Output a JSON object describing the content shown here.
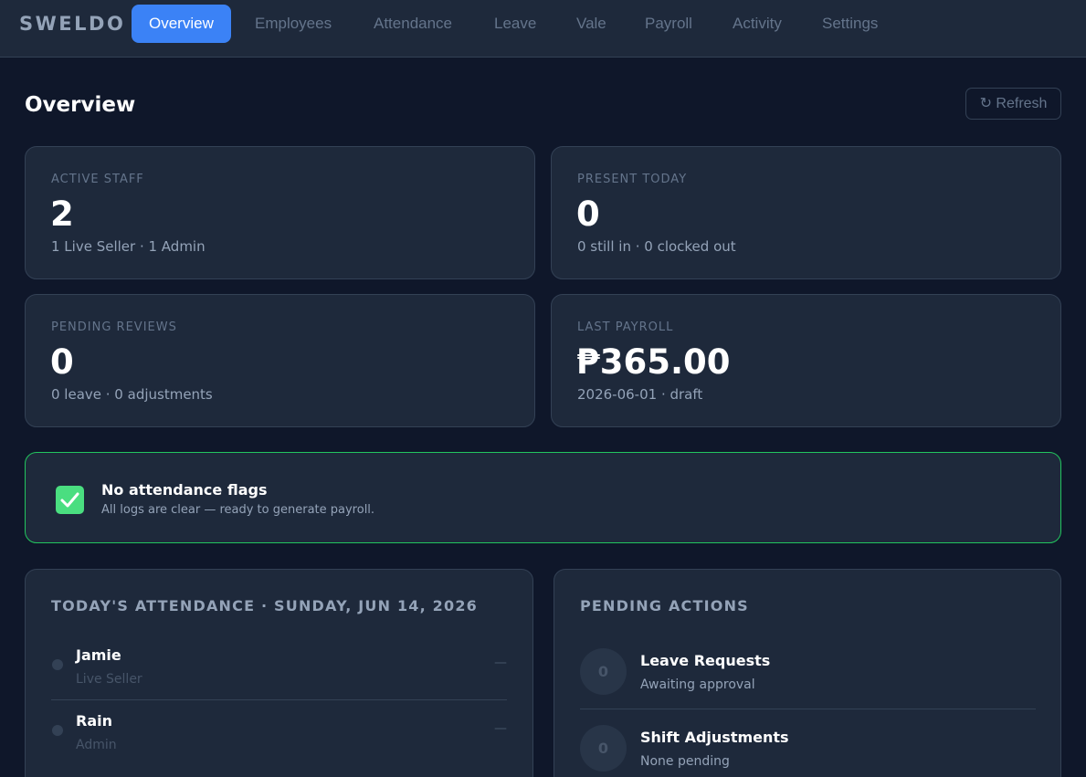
{
  "app": {
    "logo": "SWELDO"
  },
  "nav": {
    "tabs": [
      {
        "label": "Overview",
        "active": true
      },
      {
        "label": "Employees"
      },
      {
        "label": "Attendance"
      },
      {
        "label": "Leave"
      },
      {
        "label": "Vale"
      },
      {
        "label": "Payroll"
      },
      {
        "label": "Activity"
      },
      {
        "label": "Settings"
      }
    ]
  },
  "header": {
    "title": "Overview",
    "refresh_label": "↻ Refresh"
  },
  "stats": [
    {
      "label": "ACTIVE STAFF",
      "value": "2",
      "sub": "1 Live Seller · 1 Admin"
    },
    {
      "label": "PRESENT TODAY",
      "value": "0",
      "sub": "0 still in · 0 clocked out"
    },
    {
      "label": "PENDING REVIEWS",
      "value": "0",
      "sub": "0 leave · 0 adjustments"
    },
    {
      "label": "LAST PAYROLL",
      "value": "₱365.00",
      "sub": "2026-06-01 · draft"
    }
  ],
  "flag_banner": {
    "icon": "check-icon",
    "title": "No attendance flags",
    "subtitle": "All logs are clear — ready to generate payroll."
  },
  "attendance": {
    "title": "TODAY'S ATTENDANCE · SUNDAY, JUN 14, 2026",
    "rows": [
      {
        "name": "Jamie",
        "role": "Live Seller",
        "status": "—"
      },
      {
        "name": "Rain",
        "role": "Admin",
        "status": "—"
      }
    ]
  },
  "pending_actions": {
    "title": "PENDING ACTIONS",
    "items": [
      {
        "count": "0",
        "title": "Leave Requests",
        "subtitle": "Awaiting approval"
      },
      {
        "count": "0",
        "title": "Shift Adjustments",
        "subtitle": "None pending"
      }
    ]
  },
  "colors": {
    "background": "#0f172a",
    "surface": "#1e293b",
    "accent": "#3b82f6",
    "success": "#22c55e"
  }
}
